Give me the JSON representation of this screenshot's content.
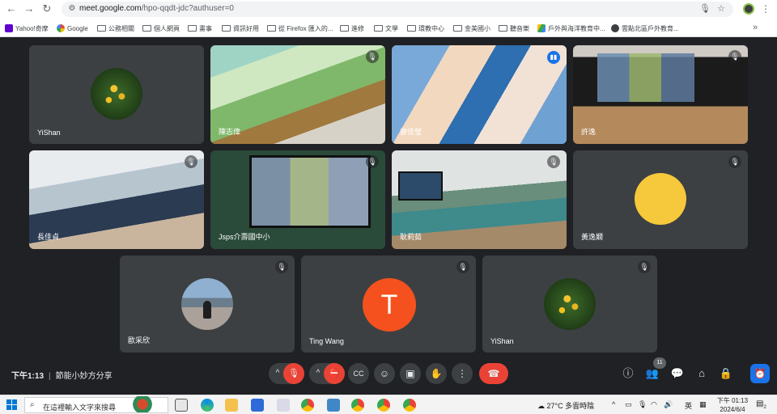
{
  "browser": {
    "url_main": "meet.google.com",
    "url_rest": "/hpo-qqdt-jdc?authuser=0",
    "icons": [
      "back-icon",
      "forward-icon",
      "reload-icon",
      "site-settings-icon",
      "mic-icon",
      "star-icon",
      "profile-avatar",
      "menu-icon"
    ],
    "bookmarks": [
      {
        "label": "Yahoo!奇摩",
        "icon": "yahoo-icon"
      },
      {
        "label": "Google",
        "icon": "google-icon"
      },
      {
        "label": "公務相關",
        "icon": "folder-icon"
      },
      {
        "label": "個人網頁",
        "icon": "folder-icon"
      },
      {
        "label": "畫事",
        "icon": "folder-icon"
      },
      {
        "label": "資訊好用",
        "icon": "folder-icon"
      },
      {
        "label": "從 Firefox 匯入的...",
        "icon": "folder-icon"
      },
      {
        "label": "進修",
        "icon": "folder-icon"
      },
      {
        "label": "文學",
        "icon": "folder-icon"
      },
      {
        "label": "環教中心",
        "icon": "folder-icon"
      },
      {
        "label": "金美國小",
        "icon": "folder-icon"
      },
      {
        "label": "聽音樂",
        "icon": "folder-icon"
      },
      {
        "label": "戶外與海洋教育中...",
        "icon": "drive-icon"
      },
      {
        "label": "雲點北區戶外教育...",
        "icon": "globe-icon"
      }
    ]
  },
  "participants": [
    {
      "name": "YiShan",
      "muted": true
    },
    {
      "name": "陳志偉",
      "muted": true
    },
    {
      "name": "謝佳瑩",
      "muted": false,
      "speaking": true
    },
    {
      "name": "許逸",
      "muted": true
    },
    {
      "name": "長佳貞",
      "muted": true
    },
    {
      "name": "Jsps介壽國中小",
      "muted": true
    },
    {
      "name": "耿莉茹",
      "muted": true
    },
    {
      "name": "黃逸嫺",
      "muted": true
    },
    {
      "name": "歐采欣",
      "muted": true
    },
    {
      "name": "Ting Wang",
      "muted": true,
      "initial": "T"
    },
    {
      "name": "YiShan",
      "muted": true
    }
  ],
  "meeting": {
    "time": "下午1:13",
    "title": "節能小妙方分享",
    "participant_count": "11",
    "colors": {
      "end_call": "#ea4335",
      "mic_off": "#ea4335",
      "accent": "#1a73e8",
      "avatar_t": "#f4511e"
    }
  },
  "taskbar": {
    "search_placeholder": "在這裡輸入文字來搜尋",
    "weather": "27°C 多雲時陰",
    "ime": "英",
    "clock_time": "下午 01:13",
    "clock_date": "2024/6/4",
    "notifications": "2"
  }
}
